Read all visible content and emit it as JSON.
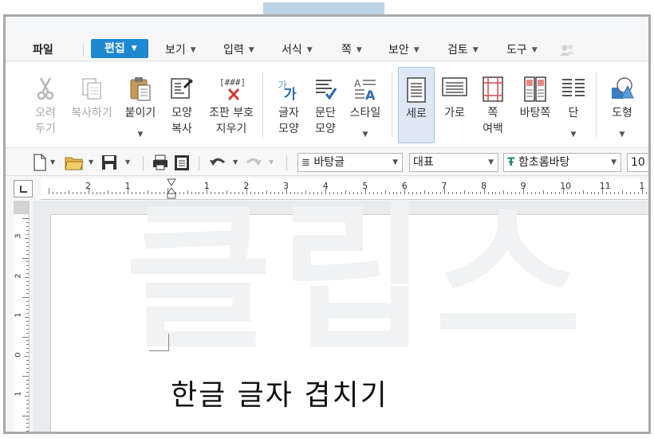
{
  "menubar": {
    "items": [
      {
        "label": "파일"
      },
      {
        "label": "편집"
      },
      {
        "label": "보기"
      },
      {
        "label": "입력"
      },
      {
        "label": "서식"
      },
      {
        "label": "쪽"
      },
      {
        "label": "보안"
      },
      {
        "label": "검토"
      },
      {
        "label": "도구"
      }
    ],
    "active": "편집"
  },
  "ribbon": {
    "buttons": [
      {
        "label": "오려\n두기",
        "icon": "scissors-icon",
        "state": "disabled"
      },
      {
        "label": "복사하기",
        "icon": "copy-icon",
        "state": "disabled"
      },
      {
        "label": "붙이기",
        "icon": "paste-icon"
      },
      {
        "label": "모양\n복사",
        "icon": "format-painter-icon"
      },
      {
        "label": "조판 부호\n지우기",
        "icon": "clear-code-icon"
      },
      {
        "label": "글자\n모양",
        "icon": "char-shape-icon"
      },
      {
        "label": "문단\n모양",
        "icon": "paragraph-shape-icon"
      },
      {
        "label": "스타일",
        "icon": "style-icon"
      },
      {
        "label": "세로",
        "icon": "portrait-icon",
        "state": "selected"
      },
      {
        "label": "가로",
        "icon": "landscape-icon"
      },
      {
        "label": "쪽\n여백",
        "icon": "page-margin-icon"
      },
      {
        "label": "바탕쪽",
        "icon": "master-page-icon"
      },
      {
        "label": "단",
        "icon": "columns-icon"
      },
      {
        "label": "도형",
        "icon": "shapes-icon"
      }
    ]
  },
  "toolbar": {
    "style_combo": "바탕글",
    "outline_combo": "대표",
    "font_combo": "함초롬바탕",
    "font_icon": "Ŧ",
    "size_combo": "10"
  },
  "ruler": {
    "numbers": [
      "2",
      "1",
      "",
      "1",
      "2",
      "3",
      "4",
      "5",
      "6",
      "7",
      "8",
      "9",
      "10",
      "11",
      "1"
    ]
  },
  "vruler": {
    "numbers": [
      "3",
      "2",
      "1",
      "0",
      "1"
    ]
  },
  "document": {
    "text": "한글 글자 겹치기",
    "watermark": "클립스"
  }
}
